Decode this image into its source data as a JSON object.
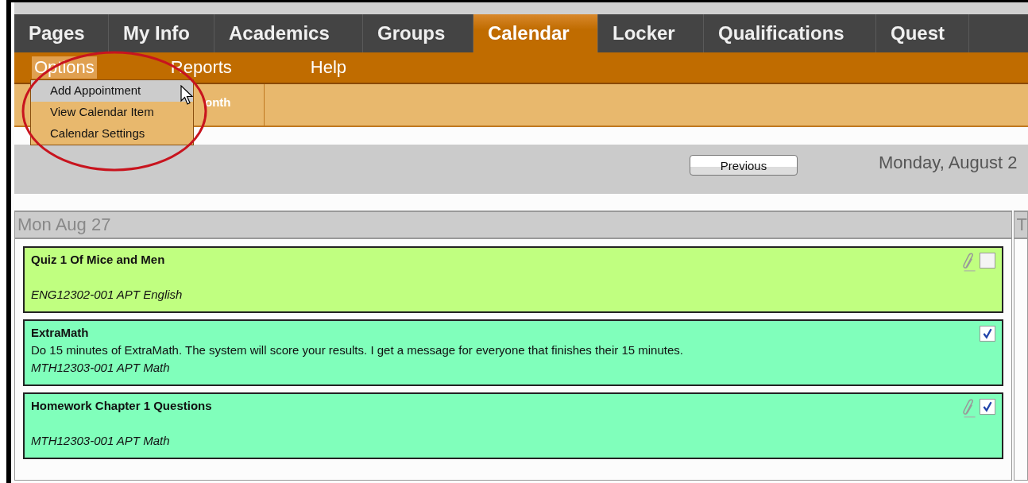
{
  "nav_tabs": [
    {
      "label": "Pages",
      "selected": false
    },
    {
      "label": "My Info",
      "selected": false
    },
    {
      "label": "Academics",
      "selected": false
    },
    {
      "label": "Groups",
      "selected": false
    },
    {
      "label": "Calendar",
      "selected": true
    },
    {
      "label": "Locker",
      "selected": false
    },
    {
      "label": "Qualifications",
      "selected": false
    },
    {
      "label": "Quest",
      "selected": false
    }
  ],
  "sub_menu": [
    {
      "label": "Options",
      "selected": true
    },
    {
      "label": "Reports",
      "selected": false
    },
    {
      "label": "Help",
      "selected": false
    }
  ],
  "options_dropdown": [
    {
      "label": "Add Appointment",
      "selected": true
    },
    {
      "label": "View Calendar Item",
      "selected": false
    },
    {
      "label": "Calendar Settings",
      "selected": false
    }
  ],
  "view_tabs": [
    {
      "label": "onth"
    }
  ],
  "toolbar": {
    "previous_button": "Previous",
    "date": "Monday, August 2"
  },
  "columns": [
    {
      "header": "Mon Aug 27",
      "items": [
        {
          "title": "Quiz 1 Of Mice and Men",
          "course": "ENG12302-001 APT English",
          "color": "#c0ff80",
          "attachment": true,
          "checked": false
        },
        {
          "title": "ExtraMath",
          "description": "Do 15 minutes of ExtraMath. The system will score your results. I get a message for everyone that finishes their 15 minutes.",
          "course": "MTH12303-001 APT Math",
          "color": "#80ffbb",
          "attachment": false,
          "checked": true
        },
        {
          "title": "Homework Chapter 1 Questions",
          "course": "MTH12303-001 APT Math",
          "color": "#80ffbb",
          "attachment": true,
          "checked": true
        }
      ]
    },
    {
      "header": "T"
    }
  ]
}
